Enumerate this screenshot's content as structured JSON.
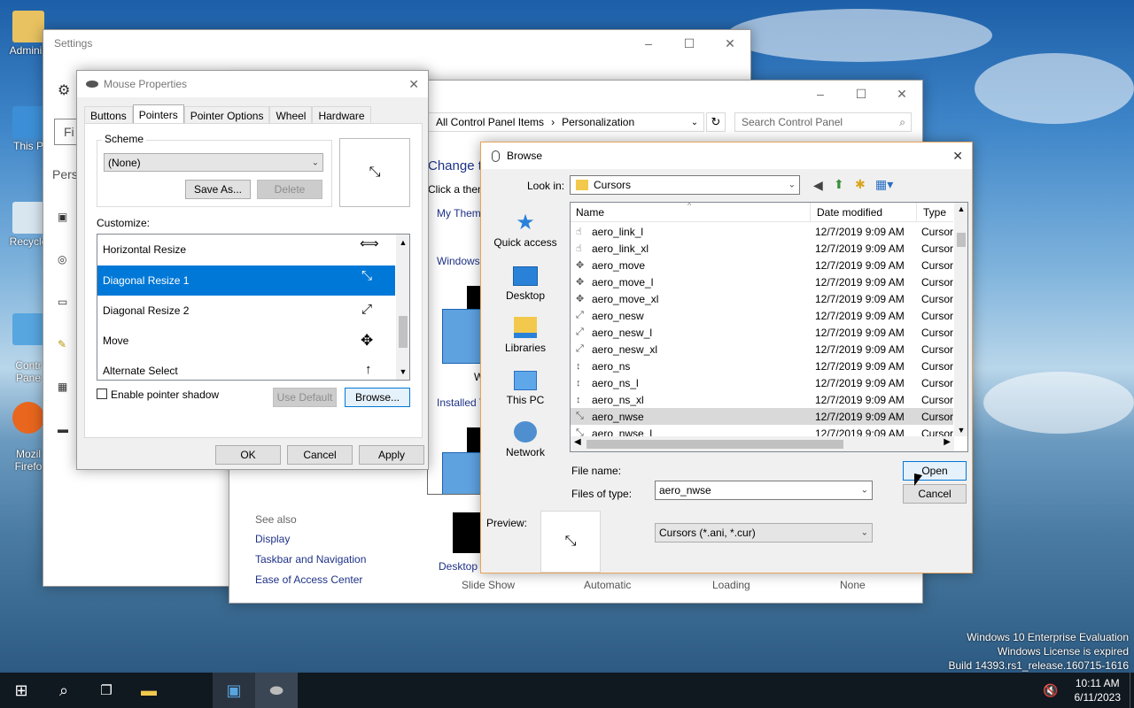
{
  "desktop": {
    "icons": [
      {
        "label": "Adminis"
      },
      {
        "label": "This P"
      },
      {
        "label": "Recycle"
      },
      {
        "label": "Contr\nPane"
      },
      {
        "label": "Mozil\nFirefo"
      }
    ],
    "watermark": {
      "line1": "Windows 10 Enterprise Evaluation",
      "line2": "Windows License is expired",
      "line3": "Build 14393.rs1_release.160715-1616"
    }
  },
  "settings": {
    "title": "Settings",
    "find_partial": "Fi",
    "pers_partial": "Pers"
  },
  "control_panel": {
    "address": "All Control Panel Items  ›  Personalization",
    "address_part1": "All Control Panel Items",
    "address_part2": "Personalization",
    "search_placeholder": "Search Control Panel",
    "heading_partial": "Change t",
    "subtext_partial": "Click a them",
    "my_themes_partial": "My Theme",
    "windows_partial": "Windows",
    "w_partial": "W",
    "installed_partial": "Installed T",
    "desktop_partial": "Desktop I",
    "see_also": "See also",
    "links": [
      "Display",
      "Taskbar and Navigation",
      "Ease of Access Center"
    ],
    "bottom_labels": [
      "Slide Show",
      "Automatic",
      "Loading",
      "None"
    ]
  },
  "mouse_properties": {
    "title": "Mouse Properties",
    "tabs": [
      "Buttons",
      "Pointers",
      "Pointer Options",
      "Wheel",
      "Hardware"
    ],
    "active_tab": "Pointers",
    "scheme_label": "Scheme",
    "scheme_value": "(None)",
    "save_as": "Save As...",
    "delete": "Delete",
    "customize_label": "Customize:",
    "items": [
      {
        "name": "Horizontal Resize",
        "glyph": "⟺",
        "selected": false
      },
      {
        "name": "Diagonal Resize 1",
        "glyph": "⤡",
        "selected": true
      },
      {
        "name": "Diagonal Resize 2",
        "glyph": "⤢",
        "selected": false
      },
      {
        "name": "Move",
        "glyph": "✥",
        "selected": false
      },
      {
        "name": "Alternate Select",
        "glyph": "↑",
        "selected": false
      }
    ],
    "preview_glyph": "⤡",
    "shadow_label": "Enable pointer shadow",
    "use_default": "Use Default",
    "browse": "Browse...",
    "ok": "OK",
    "cancel": "Cancel",
    "apply": "Apply"
  },
  "browse": {
    "title": "Browse",
    "look_in_label": "Look in:",
    "look_in_value": "Cursors",
    "places": [
      "Quick access",
      "Desktop",
      "Libraries",
      "This PC",
      "Network"
    ],
    "columns": {
      "name": "Name",
      "date": "Date modified",
      "type": "Type"
    },
    "files": [
      {
        "name": "aero_link_l",
        "date": "12/7/2019 9:09 AM",
        "type": "Cursor",
        "glyph": "☝"
      },
      {
        "name": "aero_link_xl",
        "date": "12/7/2019 9:09 AM",
        "type": "Cursor",
        "glyph": "☝"
      },
      {
        "name": "aero_move",
        "date": "12/7/2019 9:09 AM",
        "type": "Cursor",
        "glyph": "✥"
      },
      {
        "name": "aero_move_l",
        "date": "12/7/2019 9:09 AM",
        "type": "Cursor",
        "glyph": "✥"
      },
      {
        "name": "aero_move_xl",
        "date": "12/7/2019 9:09 AM",
        "type": "Cursor",
        "glyph": "✥"
      },
      {
        "name": "aero_nesw",
        "date": "12/7/2019 9:09 AM",
        "type": "Cursor",
        "glyph": "⤢"
      },
      {
        "name": "aero_nesw_l",
        "date": "12/7/2019 9:09 AM",
        "type": "Cursor",
        "glyph": "⤢"
      },
      {
        "name": "aero_nesw_xl",
        "date": "12/7/2019 9:09 AM",
        "type": "Cursor",
        "glyph": "⤢"
      },
      {
        "name": "aero_ns",
        "date": "12/7/2019 9:09 AM",
        "type": "Cursor",
        "glyph": "↕"
      },
      {
        "name": "aero_ns_l",
        "date": "12/7/2019 9:09 AM",
        "type": "Cursor",
        "glyph": "↕"
      },
      {
        "name": "aero_ns_xl",
        "date": "12/7/2019 9:09 AM",
        "type": "Cursor",
        "glyph": "↕"
      },
      {
        "name": "aero_nwse",
        "date": "12/7/2019 9:09 AM",
        "type": "Cursor",
        "glyph": "⤡",
        "selected": true
      },
      {
        "name": "aero_nwse_l",
        "date": "12/7/2019 9:09 AM",
        "type": "Cursor",
        "glyph": "⤡"
      }
    ],
    "file_name_label": "File name:",
    "file_name_value": "aero_nwse",
    "file_type_label": "Files of type:",
    "file_type_value": "Cursors (*.ani, *.cur)",
    "open": "Open",
    "cancel": "Cancel",
    "preview_label": "Preview:",
    "preview_glyph": "⤡"
  },
  "taskbar": {
    "time": "10:11 AM",
    "date": "6/11/2023"
  },
  "colors": {
    "selection": "#0078d7",
    "row_selected": "#d9d9d9",
    "taskbar": "#101820"
  }
}
